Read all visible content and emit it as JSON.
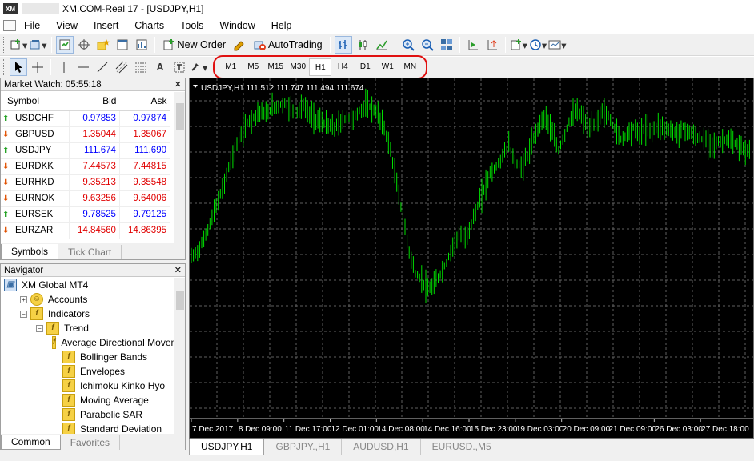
{
  "window": {
    "title": "XM.COM-Real 17 - [USDJPY,H1]",
    "logo": "XM"
  },
  "menu": [
    "File",
    "View",
    "Insert",
    "Charts",
    "Tools",
    "Window",
    "Help"
  ],
  "toolbar1": {
    "new_order": "New Order",
    "autotrading": "AutoTrading"
  },
  "toolbar2": {
    "tool_label": "A",
    "timeframes": [
      "M1",
      "M5",
      "M15",
      "M30",
      "H1",
      "H4",
      "D1",
      "W1",
      "MN"
    ],
    "active_timeframe": "H1",
    "highlight_color": "#e01010"
  },
  "market_watch": {
    "title": "Market Watch: 05:55:18",
    "columns": [
      "Symbol",
      "Bid",
      "Ask"
    ],
    "rows": [
      {
        "symbol": "USDCHF",
        "bid": "0.97853",
        "ask": "0.97874",
        "dir": "up"
      },
      {
        "symbol": "GBPUSD",
        "bid": "1.35044",
        "ask": "1.35067",
        "dir": "down"
      },
      {
        "symbol": "USDJPY",
        "bid": "111.674",
        "ask": "111.690",
        "dir": "up"
      },
      {
        "symbol": "EURDKK",
        "bid": "7.44573",
        "ask": "7.44815",
        "dir": "down"
      },
      {
        "symbol": "EURHKD",
        "bid": "9.35213",
        "ask": "9.35548",
        "dir": "down"
      },
      {
        "symbol": "EURNOK",
        "bid": "9.63256",
        "ask": "9.64006",
        "dir": "down"
      },
      {
        "symbol": "EURSEK",
        "bid": "9.78525",
        "ask": "9.79125",
        "dir": "up"
      },
      {
        "symbol": "EURZAR",
        "bid": "14.84560",
        "ask": "14.86395",
        "dir": "down"
      }
    ],
    "tabs": [
      "Symbols",
      "Tick Chart"
    ]
  },
  "navigator": {
    "title": "Navigator",
    "items": [
      {
        "label": "XM Global MT4",
        "level": 0,
        "toggle": "",
        "icon": "terminal-icon"
      },
      {
        "label": "Accounts",
        "level": 1,
        "toggle": "+",
        "icon": "accounts-icon"
      },
      {
        "label": "Indicators",
        "level": 1,
        "toggle": "−",
        "icon": "indicator-folder-icon"
      },
      {
        "label": "Trend",
        "level": 2,
        "toggle": "−",
        "icon": "indicator-folder-icon"
      },
      {
        "label": "Average Directional Movement Index",
        "level": 3,
        "toggle": "",
        "icon": "indicator-icon"
      },
      {
        "label": "Bollinger Bands",
        "level": 3,
        "toggle": "",
        "icon": "indicator-icon"
      },
      {
        "label": "Envelopes",
        "level": 3,
        "toggle": "",
        "icon": "indicator-icon"
      },
      {
        "label": "Ichimoku Kinko Hyo",
        "level": 3,
        "toggle": "",
        "icon": "indicator-icon"
      },
      {
        "label": "Moving Average",
        "level": 3,
        "toggle": "",
        "icon": "indicator-icon"
      },
      {
        "label": "Parabolic SAR",
        "level": 3,
        "toggle": "",
        "icon": "indicator-icon"
      },
      {
        "label": "Standard Deviation",
        "level": 3,
        "toggle": "",
        "icon": "indicator-icon"
      }
    ],
    "tabs": [
      "Common",
      "Favorites"
    ]
  },
  "chart": {
    "header": "USDJPY,H1  111.512 111.747 111.494 111.674",
    "x_labels": [
      "7 Dec 2017",
      "8 Dec 09:00",
      "11 Dec 17:00",
      "12 Dec 01:00",
      "14 Dec 08:00",
      "14 Dec 16:00",
      "15 Dec 23:00",
      "19 Dec 03:00",
      "20 Dec 09:00",
      "21 Dec 09:00",
      "26 Dec 03:00",
      "27 Dec 18:00"
    ],
    "bar_color": "#00e000",
    "grid_color": "#606060",
    "background": "#000000",
    "tabs": [
      "USDJPY,H1",
      "GBPJPY.,H1",
      "AUDUSD,H1",
      "EURUSD.,M5"
    ]
  },
  "chart_data": {
    "type": "line",
    "title": "USDJPY,H1",
    "ohlc_header": {
      "open": 111.512,
      "high": 111.747,
      "low": 111.494,
      "close": 111.674
    },
    "series": [
      {
        "values": [
          112.25,
          112.3,
          112.4,
          112.55,
          112.7,
          112.85,
          113.05,
          113.2,
          113.35,
          113.45,
          113.5,
          113.55,
          113.52,
          113.58,
          113.6,
          113.62,
          113.58,
          113.55,
          113.6,
          113.52,
          113.48,
          113.45,
          113.42,
          113.4,
          113.45,
          113.5,
          113.48,
          113.55,
          113.6,
          113.58,
          113.52,
          113.4,
          113.2,
          112.9,
          112.6,
          112.3,
          112.1,
          112.05,
          111.95,
          112.0,
          112.1,
          112.2,
          112.35,
          112.45,
          112.4,
          112.55,
          112.7,
          112.85,
          113.0,
          113.05,
          113.15,
          113.25,
          113.1,
          113.05,
          113.15,
          113.3,
          113.45,
          113.5,
          113.35,
          113.2,
          113.35,
          113.5,
          113.55,
          113.48,
          113.4,
          113.45,
          113.55,
          113.5,
          113.4,
          113.3,
          113.35,
          113.4,
          113.35,
          113.4,
          113.38,
          113.42,
          113.4,
          113.38,
          113.35,
          113.4,
          113.36,
          113.32,
          113.3,
          113.28,
          113.25,
          113.28,
          113.3,
          113.26,
          113.24,
          113.2
        ]
      }
    ]
  }
}
